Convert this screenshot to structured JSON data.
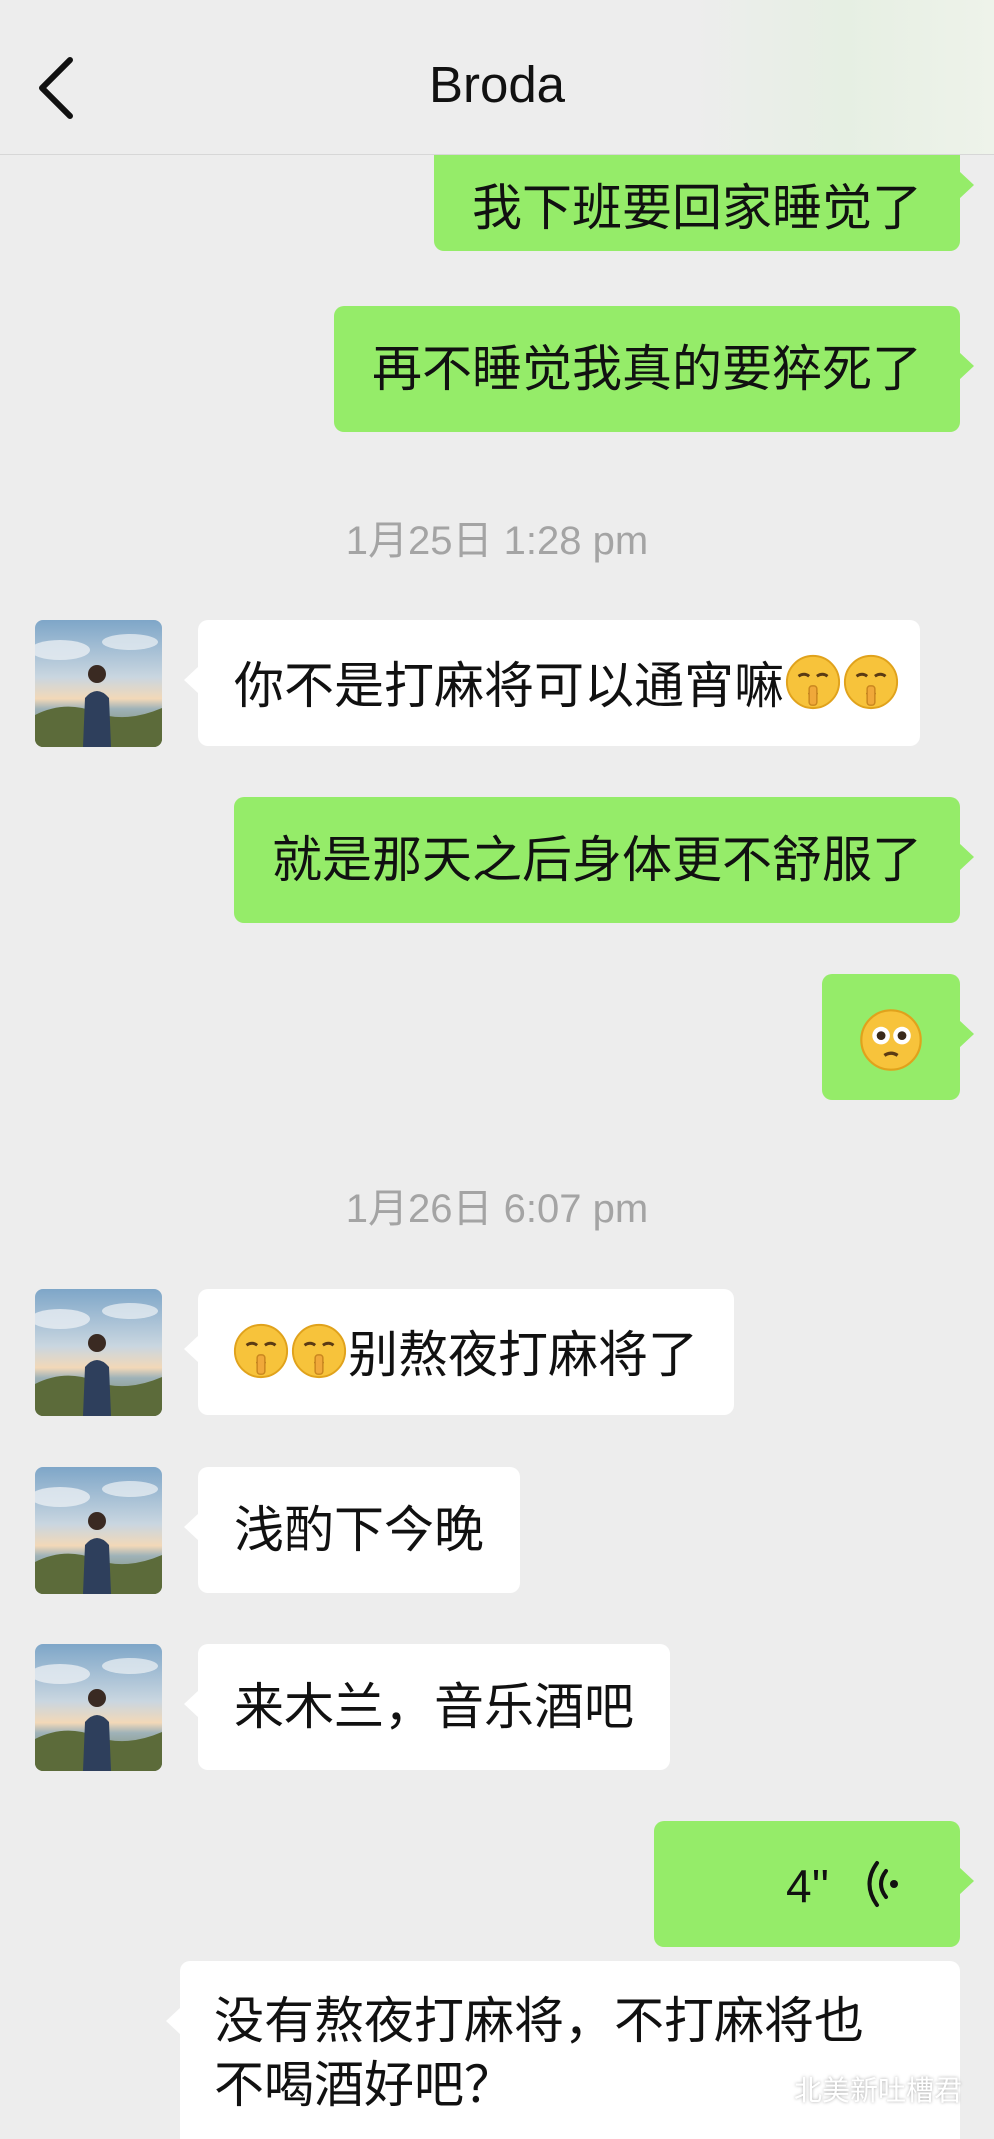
{
  "header": {
    "title": "Broda",
    "back_icon": "chevron-left-icon"
  },
  "colors": {
    "background": "#ededed",
    "outgoing_bubble": "#95ec69",
    "incoming_bubble": "#ffffff",
    "timestamp": "#a4a4a4"
  },
  "messages": [
    {
      "direction": "out",
      "text": "我下班要回家睡觉了"
    },
    {
      "direction": "out",
      "text": "再不睡觉我真的要猝死了"
    },
    {
      "type": "timestamp",
      "text": "1月25日 1:28 pm"
    },
    {
      "direction": "in",
      "text": "你不是打麻将可以通宵嘛",
      "emoji_suffix": [
        "shushing-face",
        "shushing-face"
      ]
    },
    {
      "direction": "out",
      "text": "就是那天之后身体更不舒服了"
    },
    {
      "direction": "out",
      "emoji": "dizzy-face"
    },
    {
      "type": "timestamp",
      "text": "1月26日 6:07 pm"
    },
    {
      "direction": "in",
      "emoji_prefix": [
        "shushing-face",
        "shushing-face"
      ],
      "text": "别熬夜打麻将了"
    },
    {
      "direction": "in",
      "text": "浅酌下今晚"
    },
    {
      "direction": "in",
      "text": "来木兰，音乐酒吧"
    },
    {
      "direction": "out",
      "type": "voice",
      "duration": "4''",
      "icon": "voice-wave-icon"
    },
    {
      "direction": "out",
      "text": "没有熬夜打麻将，不打麻将也不喝酒好吧？",
      "lines": [
        "没有熬夜打麻将，不打麻将也",
        "不喝酒好吧？"
      ]
    }
  ],
  "watermark": {
    "text": "北美新吐槽君",
    "icon": "wechat-icon"
  }
}
